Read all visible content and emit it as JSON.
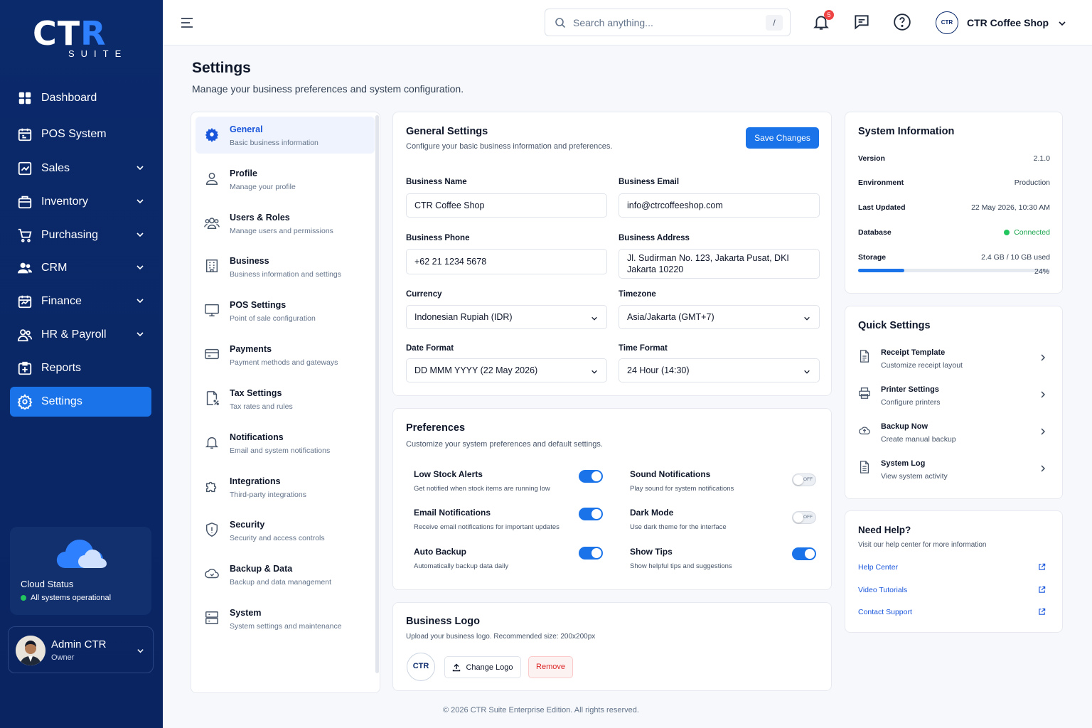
{
  "brand": {
    "logo_main": "CT",
    "logo_accent": "R",
    "logo_sub": "SUITE"
  },
  "nav": [
    {
      "label": "Dashboard",
      "icon": "dashboard-icon"
    },
    {
      "label": "POS System",
      "icon": "pos-icon"
    },
    {
      "label": "Sales",
      "icon": "sales-icon",
      "expandable": true
    },
    {
      "label": "Inventory",
      "icon": "inventory-icon",
      "expandable": true
    },
    {
      "label": "Purchasing",
      "icon": "cart-icon",
      "expandable": true
    },
    {
      "label": "CRM",
      "icon": "users-icon",
      "expandable": true
    },
    {
      "label": "Finance",
      "icon": "finance-icon",
      "expandable": true
    },
    {
      "label": "HR & Payroll",
      "icon": "hr-icon",
      "expandable": true
    },
    {
      "label": "Reports",
      "icon": "reports-icon"
    },
    {
      "label": "Settings",
      "icon": "gear-icon",
      "active": true
    }
  ],
  "cloud": {
    "title": "Cloud Status",
    "status": "All systems operational"
  },
  "user": {
    "name": "Admin CTR",
    "role": "Owner"
  },
  "topbar": {
    "search_placeholder": "Search anything...",
    "search_shortcut": "/",
    "notif_count": "5",
    "shop_logo": "CTR",
    "shop_name": "CTR Coffee Shop"
  },
  "page": {
    "title": "Settings",
    "subtitle": "Manage your business preferences and system configuration."
  },
  "settings_menu": [
    {
      "title": "General",
      "sub": "Basic business information",
      "active": true
    },
    {
      "title": "Profile",
      "sub": "Manage your profile"
    },
    {
      "title": "Users & Roles",
      "sub": "Manage users and permissions"
    },
    {
      "title": "Business",
      "sub": "Business information and settings"
    },
    {
      "title": "POS Settings",
      "sub": "Point of sale configuration"
    },
    {
      "title": "Payments",
      "sub": "Payment methods and gateways"
    },
    {
      "title": "Tax Settings",
      "sub": "Tax rates and rules"
    },
    {
      "title": "Notifications",
      "sub": "Email and system notifications"
    },
    {
      "title": "Integrations",
      "sub": "Third-party integrations"
    },
    {
      "title": "Security",
      "sub": "Security and access controls"
    },
    {
      "title": "Backup & Data",
      "sub": "Backup and data management"
    },
    {
      "title": "System",
      "sub": "System settings and maintenance"
    }
  ],
  "general": {
    "title": "General Settings",
    "subtitle": "Configure your basic business information and preferences.",
    "save_label": "Save Changes",
    "fields": {
      "business_name": {
        "label": "Business Name",
        "value": "CTR Coffee Shop"
      },
      "business_email": {
        "label": "Business Email",
        "value": "info@ctrcoffeeshop.com"
      },
      "business_phone": {
        "label": "Business Phone",
        "value": "+62 21 1234 5678"
      },
      "business_address": {
        "label": "Business Address",
        "value": "Jl. Sudirman No. 123, Jakarta Pusat, DKI Jakarta 10220"
      },
      "currency": {
        "label": "Currency",
        "value": "Indonesian Rupiah (IDR)"
      },
      "timezone": {
        "label": "Timezone",
        "value": "Asia/Jakarta (GMT+7)"
      },
      "date_format": {
        "label": "Date Format",
        "value": "DD MMM YYYY (22 May 2026)"
      },
      "time_format": {
        "label": "Time Format",
        "value": "24 Hour (14:30)"
      }
    }
  },
  "preferences": {
    "title": "Preferences",
    "subtitle": "Customize your system preferences and default settings.",
    "off_label": "OFF",
    "items": [
      {
        "title": "Low Stock Alerts",
        "sub": "Get notified when stock items are running low",
        "on": true
      },
      {
        "title": "Sound Notifications",
        "sub": "Play sound for system notifications",
        "on": false
      },
      {
        "title": "Email Notifications",
        "sub": "Receive email notifications for important updates",
        "on": true
      },
      {
        "title": "Dark Mode",
        "sub": "Use dark theme for the interface",
        "on": false
      },
      {
        "title": "Auto Backup",
        "sub": "Automatically backup data daily",
        "on": true
      },
      {
        "title": "Show Tips",
        "sub": "Show helpful tips and suggestions",
        "on": true
      }
    ]
  },
  "logo_card": {
    "title": "Business Logo",
    "subtitle": "Upload your business logo. Recommended size: 200x200px",
    "logo_text": "CTR",
    "change_label": "Change Logo",
    "remove_label": "Remove"
  },
  "system_info": {
    "title": "System Information",
    "rows": [
      {
        "key": "Version",
        "value": "2.1.0"
      },
      {
        "key": "Environment",
        "value": "Production"
      },
      {
        "key": "Last Updated",
        "value": "22 May 2026, 10:30 AM"
      },
      {
        "key": "Database",
        "value": "Connected"
      },
      {
        "key": "Storage",
        "value": "2.4 GB / 10 GB used"
      }
    ],
    "storage_percent_label": "24%",
    "storage_fraction": 0.24
  },
  "quick_settings": {
    "title": "Quick Settings",
    "items": [
      {
        "title": "Receipt Template",
        "sub": "Customize receipt layout",
        "icon": "document-icon"
      },
      {
        "title": "Printer Settings",
        "sub": "Configure printers",
        "icon": "printer-icon"
      },
      {
        "title": "Backup Now",
        "sub": "Create manual backup",
        "icon": "cloud-upload-icon"
      },
      {
        "title": "System Log",
        "sub": "View system activity",
        "icon": "log-icon"
      }
    ]
  },
  "help": {
    "title": "Need Help?",
    "subtitle": "Visit our help center for more information",
    "links": [
      "Help Center",
      "Video Tutorials",
      "Contact Support"
    ]
  },
  "footer": "© 2026 CTR Suite Enterprise Edition. All rights reserved.",
  "colors": {
    "primary": "#1a73e8",
    "sidebar": "#0b2a6b",
    "success": "#22c55e",
    "danger": "#dc2626"
  }
}
